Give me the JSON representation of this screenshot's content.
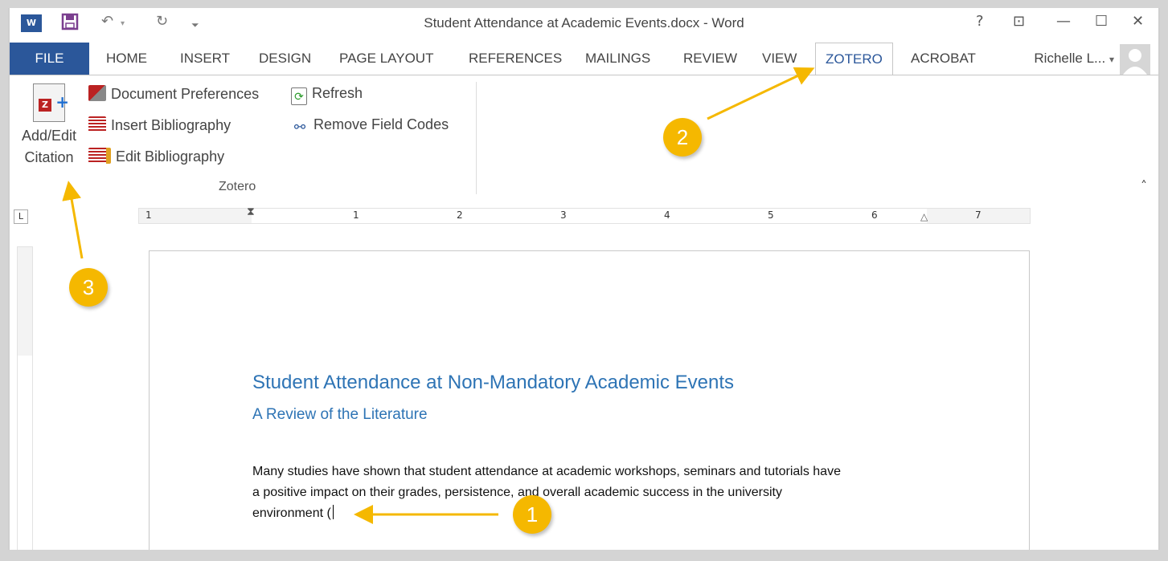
{
  "window": {
    "title": "Student Attendance at Academic Events.docx - Word",
    "help": "?",
    "controls": {
      "ribbon_display": "⊡",
      "minimize": "—",
      "maximize": "☐",
      "close": "✕"
    }
  },
  "quick_access": {
    "app_icon": "W",
    "save": "save-icon",
    "undo": "↶",
    "redo": "↻",
    "customize": "⯆"
  },
  "tabs": [
    {
      "label": "FILE"
    },
    {
      "label": "HOME"
    },
    {
      "label": "INSERT"
    },
    {
      "label": "DESIGN"
    },
    {
      "label": "PAGE LAYOUT"
    },
    {
      "label": "REFERENCES"
    },
    {
      "label": "MAILINGS"
    },
    {
      "label": "REVIEW"
    },
    {
      "label": "VIEW"
    },
    {
      "label": "ZOTERO"
    },
    {
      "label": "ACROBAT"
    }
  ],
  "user": {
    "name": "Richelle L...",
    "caret": "▾"
  },
  "ribbon": {
    "add_edit_citation": "Add/Edit Citation",
    "add_edit_line1": "Add/Edit",
    "add_edit_line2": "Citation",
    "document_preferences": "Document Preferences",
    "insert_bibliography": "Insert Bibliography",
    "edit_bibliography": "Edit Bibliography",
    "refresh": "Refresh",
    "remove_field_codes": "Remove Field Codes",
    "group_label": "Zotero",
    "collapse": "˄"
  },
  "ruler": {
    "corner": "L",
    "marks": [
      "1",
      "1",
      "2",
      "3",
      "4",
      "5",
      "6",
      "7"
    ]
  },
  "document": {
    "title": "Student Attendance at Non-Mandatory Academic Events",
    "subtitle": "A Review of the Literature",
    "body_line1": "Many studies have shown that student attendance at academic workshops, seminars and tutorials have",
    "body_line2": "a positive impact on their grades, persistence, and overall academic success in the university",
    "body_line3": "environment ("
  },
  "annotations": {
    "badge1": "1",
    "badge2": "2",
    "badge3": "3",
    "color": "#f5b800"
  }
}
